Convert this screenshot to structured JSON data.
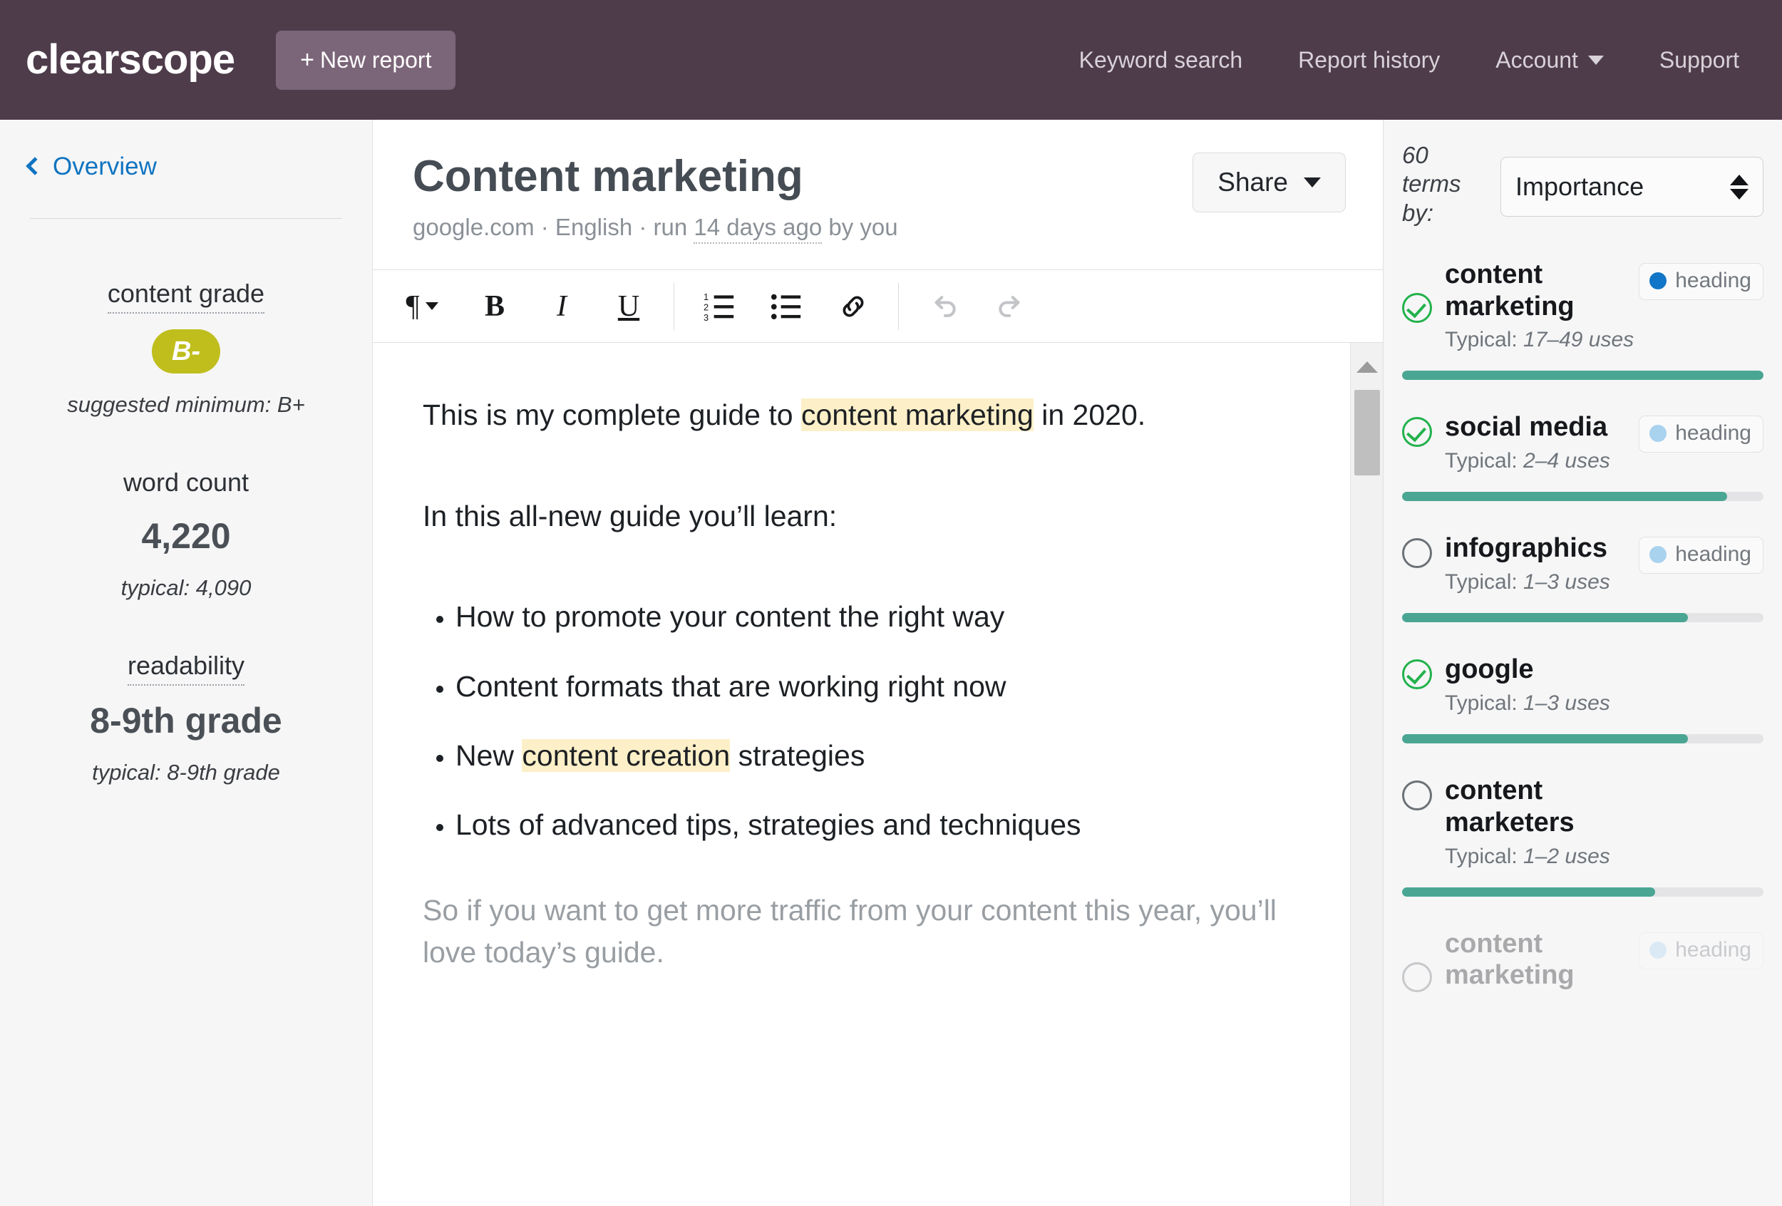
{
  "topnav": {
    "brand": "clearscope",
    "new_report_label": "New report",
    "new_report_plus": "+",
    "links": [
      {
        "label": "Keyword search",
        "has_caret": false
      },
      {
        "label": "Report history",
        "has_caret": false
      },
      {
        "label": "Account",
        "has_caret": true
      },
      {
        "label": "Support",
        "has_caret": false
      }
    ],
    "bg_color": "#4e3c4b",
    "button_color": "#7b6578"
  },
  "sidebar": {
    "overview_label": "Overview",
    "content_grade": {
      "label": "content grade",
      "value": "B-",
      "badge_color": "#bfbe1d",
      "sub": "suggested minimum: B+"
    },
    "word_count": {
      "label": "word count",
      "value": "4,220",
      "sub": "typical: 4,090"
    },
    "readability": {
      "label": "readability",
      "value": "8-9th grade",
      "sub": "typical: 8-9th grade"
    }
  },
  "document": {
    "title": "Content marketing",
    "meta_prefix": "google.com · English · run ",
    "meta_dotted": "14 days ago",
    "meta_suffix": " by you",
    "share_label": "Share"
  },
  "toolbar": {
    "paragraph": "¶",
    "bold": "B",
    "italic": "I",
    "underline": "U",
    "ordered_list": "ordered-list",
    "bullet_list": "bullet-list",
    "link": "link",
    "undo": "undo",
    "redo": "redo"
  },
  "editor": {
    "p1_before": "This is my complete guide to ",
    "p1_highlight": "content marketing",
    "p1_after": " in 2020.",
    "p2": "In this all-new guide you’ll learn:",
    "bullets": [
      {
        "text": "How to promote your content the right way"
      },
      {
        "text": "Content formats that are working right now"
      },
      {
        "before": "New ",
        "highlight": "content creation",
        "after": " strategies"
      },
      {
        "text": "Lots of advanced tips, strategies and techniques"
      }
    ],
    "p3": "So if you want to get more traffic from your content this year, you’ll love today’s guide.",
    "highlight_color": "#fdf0c8"
  },
  "scrollbar": {
    "arrow": "scroll-up"
  },
  "terms_panel": {
    "count_text": "60 terms by:",
    "sort_value": "Importance",
    "badge_label": "heading",
    "typical_prefix": "Typical: ",
    "terms": [
      {
        "name": "content marketing",
        "typical": "17–49 uses",
        "checked": true,
        "badge": true,
        "badge_dot": "#1176c7",
        "fill": 100
      },
      {
        "name": "social media",
        "typical": "2–4 uses",
        "checked": true,
        "badge": true,
        "badge_dot": "#a9d2ef",
        "fill": 90
      },
      {
        "name": "infographics",
        "typical": "1–3 uses",
        "checked": false,
        "badge": true,
        "badge_dot": "#a9d2ef",
        "fill": 79
      },
      {
        "name": "google",
        "typical": "1–3 uses",
        "checked": true,
        "badge": false,
        "badge_dot": "#a9d2ef",
        "fill": 79
      },
      {
        "name": "content marketers",
        "typical": "1–2 uses",
        "checked": false,
        "badge": false,
        "badge_dot": "#a9d2ef",
        "fill": 70
      },
      {
        "name": "content marketing",
        "typical": "",
        "checked": false,
        "badge": true,
        "badge_dot": "#d4e7f7",
        "fill": 0
      }
    ]
  }
}
